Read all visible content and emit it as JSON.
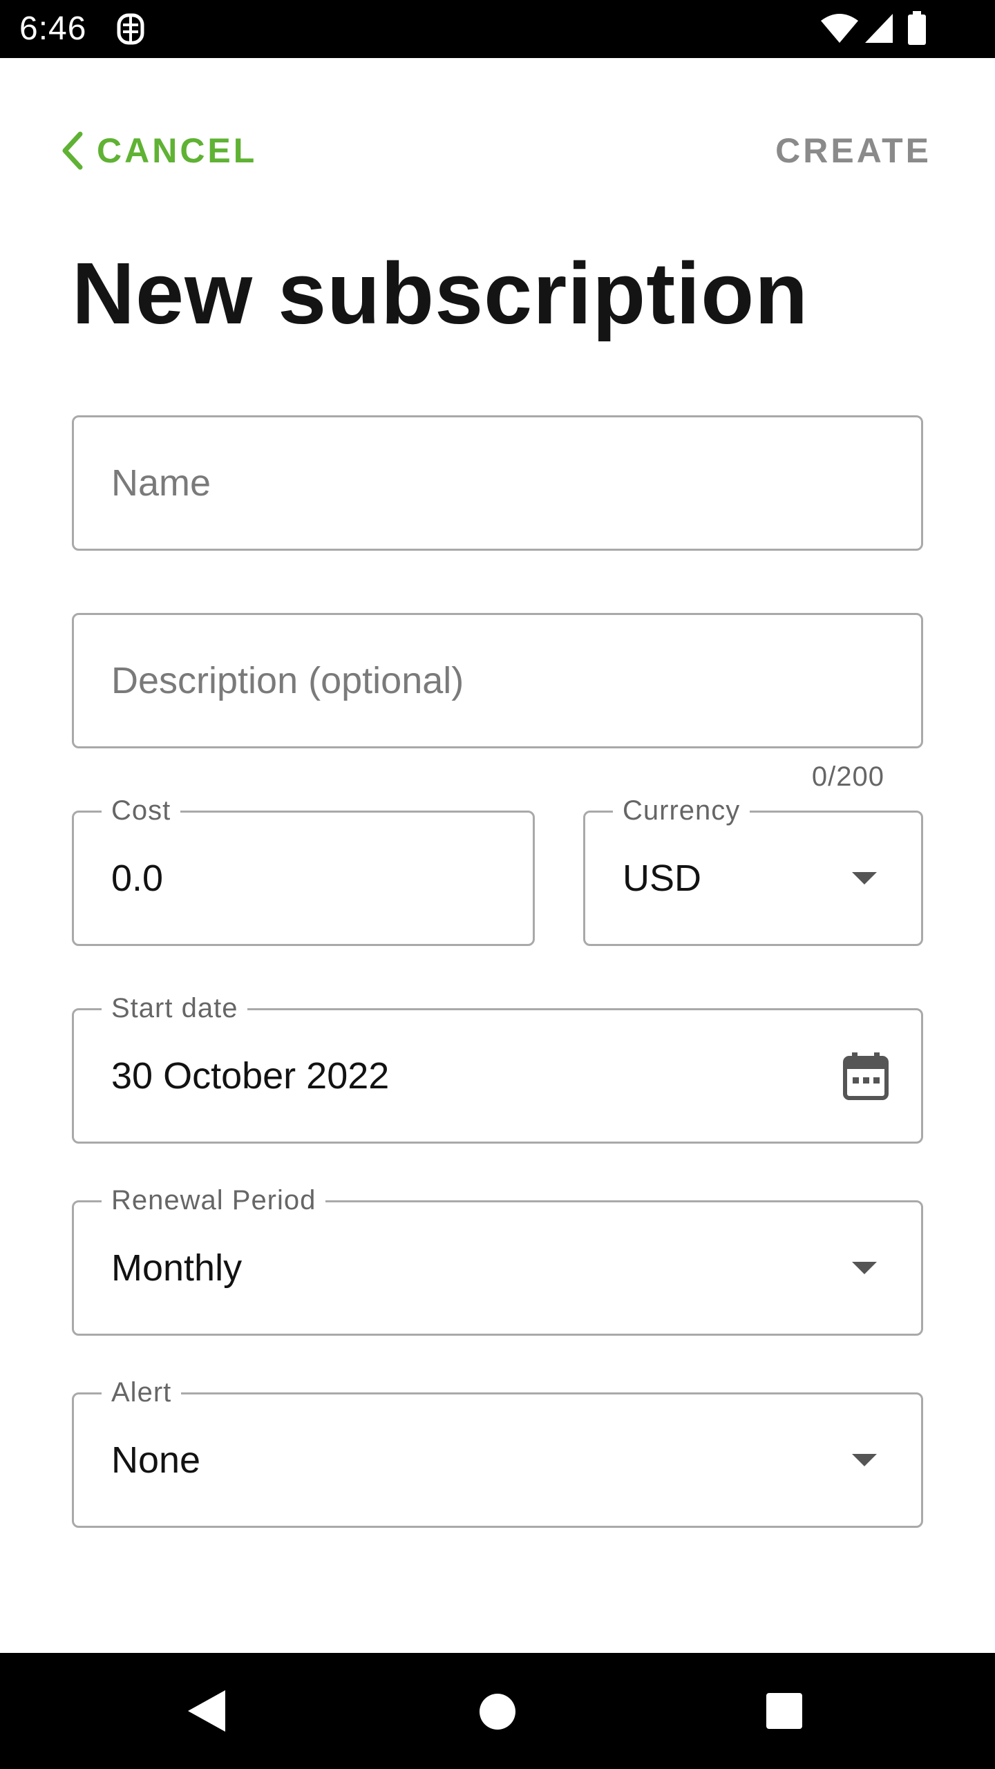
{
  "status_bar": {
    "time": "6:46",
    "icons": [
      "app-notification-icon",
      "wifi-icon",
      "cell-signal-icon",
      "battery-icon"
    ]
  },
  "header": {
    "cancel_label": "CANCEL",
    "create_label": "CREATE",
    "title": "New subscription"
  },
  "form": {
    "name": {
      "placeholder": "Name",
      "value": ""
    },
    "description": {
      "placeholder": "Description (optional)",
      "value": "",
      "counter": "0/200"
    },
    "cost": {
      "label": "Cost",
      "value": "0.0"
    },
    "currency": {
      "label": "Currency",
      "value": "USD"
    },
    "start_date": {
      "label": "Start date",
      "value": "30 October 2022"
    },
    "renewal_period": {
      "label": "Renewal Period",
      "value": "Monthly"
    },
    "alert": {
      "label": "Alert",
      "value": "None"
    }
  },
  "colors": {
    "accent": "#5fb233",
    "disabled_action": "#8a8a8a",
    "field_border": "#a9a9a9",
    "title_text": "#141414"
  },
  "nav_bar": {
    "icons": [
      "back-icon",
      "home-icon",
      "recents-icon"
    ]
  }
}
